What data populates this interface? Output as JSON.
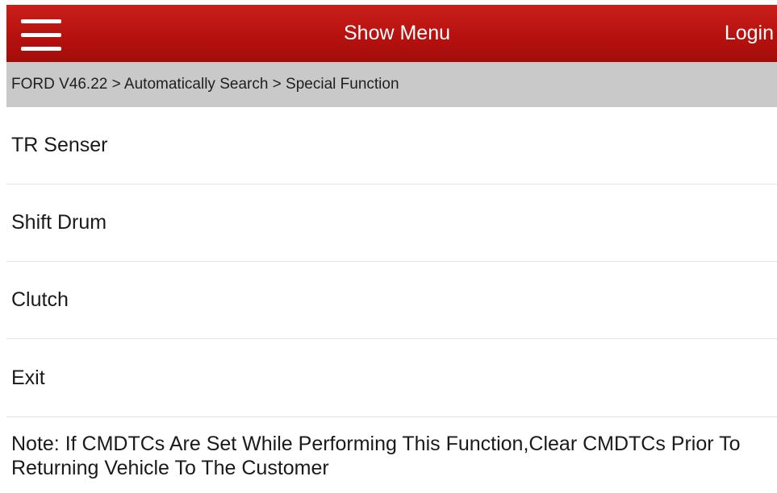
{
  "header": {
    "menu_icon": "hamburger-menu-icon",
    "title": "Show Menu",
    "login_label": "Login"
  },
  "breadcrumb": {
    "text": "FORD V46.22 > Automatically Search > Special Function"
  },
  "menu": {
    "items": [
      {
        "label": "TR Senser"
      },
      {
        "label": "Shift Drum"
      },
      {
        "label": "Clutch"
      },
      {
        "label": "Exit"
      }
    ]
  },
  "note": {
    "text": "Note: If CMDTCs Are Set While Performing This Function,Clear CMDTCs Prior To Returning Vehicle To The Customer"
  },
  "colors": {
    "header_red": "#b7110f",
    "breadcrumb_gray": "#c9c9c9",
    "text_dark": "#1a1a1a",
    "divider": "#e3e3e3"
  }
}
